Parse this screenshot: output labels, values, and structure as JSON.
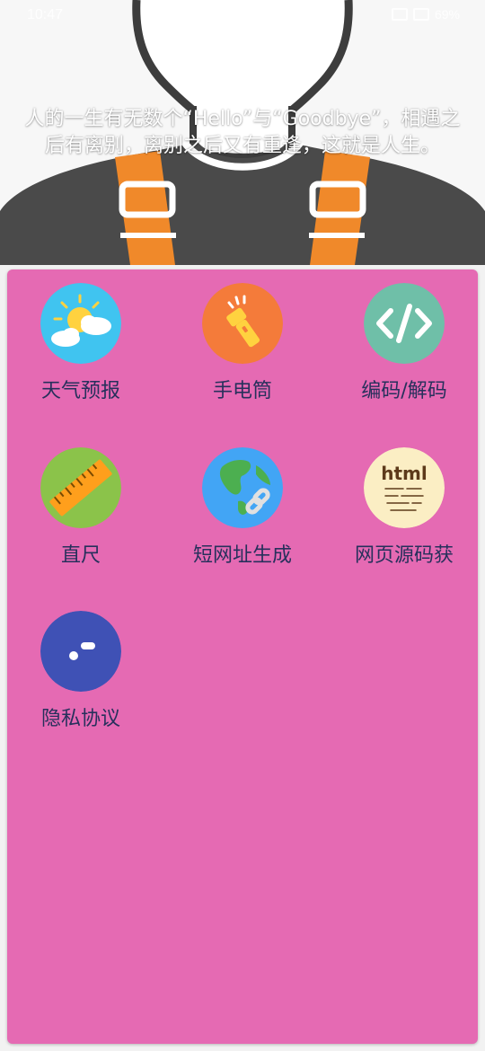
{
  "status_bar": {
    "time": "10:47",
    "battery": "69%"
  },
  "header": {
    "quote_line1": "人的一生有无数个“Hello”与“Goodbye”，相遇之",
    "quote_line2": "后有离别，离别之后又有重逢，这就是人生。"
  },
  "tools": [
    {
      "label": "天气预报",
      "icon": "weather-icon",
      "color": "#40c4f0"
    },
    {
      "label": "手电筒",
      "icon": "flashlight-icon",
      "color": "#f47b3a"
    },
    {
      "label": "编码/解码",
      "icon": "code-icon",
      "color": "#6fbfa8"
    },
    {
      "label": "直尺",
      "icon": "ruler-icon",
      "color": "#8bc34a"
    },
    {
      "label": "短网址生成",
      "icon": "globe-link-icon",
      "color": "#42a5f5"
    },
    {
      "label": "网页源码获",
      "icon": "html-icon",
      "color": "#fbeec4"
    },
    {
      "label": "隐私协议",
      "icon": "privacy-icon",
      "color": "#3f51b5"
    }
  ],
  "colors": {
    "card_bg": "#e56ab3",
    "label_text": "#27305c",
    "header_shirt": "#4a4a4a",
    "header_strap": "#f0892a"
  }
}
